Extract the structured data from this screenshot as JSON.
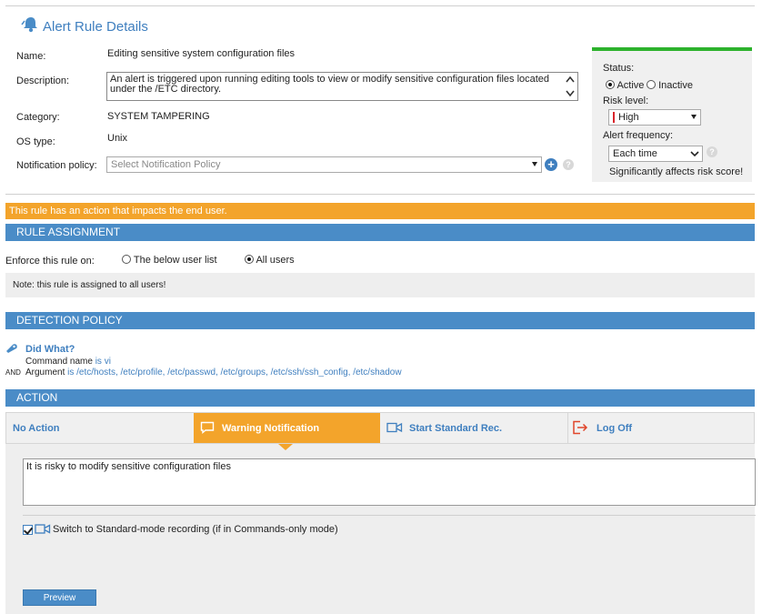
{
  "header": {
    "title": "Alert Rule Details",
    "icon": "bell-icon"
  },
  "details": {
    "name_label": "Name:",
    "name_value": "Editing sensitive system configuration files",
    "description_label": "Description:",
    "description_value": "An alert is triggered upon running editing tools to view or modify sensitive configuration files located under the /ETC directory.",
    "category_label": "Category:",
    "category_value": "SYSTEM TAMPERING",
    "os_label": "OS type:",
    "os_value": "Unix",
    "notification_label": "Notification policy:",
    "notification_placeholder": "Select Notification Policy",
    "add_symbol": "+",
    "help_symbol": "?"
  },
  "status_panel": {
    "status_label": "Status:",
    "active_label": "Active",
    "inactive_label": "Inactive",
    "active_selected": true,
    "risk_label": "Risk level:",
    "risk_value": "High",
    "risk_color": "#d9242b",
    "freq_label": "Alert frequency:",
    "freq_value": "Each time",
    "freq_note": "Significantly affects risk score!",
    "accent": "#2db22d"
  },
  "warning_bar": "This rule has an action that impacts the end user.",
  "rule_assignment": {
    "title": "RULE ASSIGNMENT",
    "enforce_label": "Enforce this rule on:",
    "option_user_list": "The below user list",
    "option_all_users": "All users",
    "all_users_selected": true,
    "note": "Note: this rule is assigned to all users!"
  },
  "detection_policy": {
    "title": "DETECTION POLICY",
    "heading": "Did What?",
    "cmd_label": "Command name",
    "cmd_op": "is",
    "cmd_value": "vi",
    "and_label": "AND",
    "arg_label": "Argument",
    "arg_op": "is",
    "arg_value": "/etc/hosts, /etc/profile, /etc/passwd, /etc/groups, /etc/ssh/ssh_config, /etc/shadow"
  },
  "action": {
    "title": "ACTION",
    "tabs": [
      {
        "label": "No Action",
        "icon": ""
      },
      {
        "label": "Warning Notification",
        "icon": "chat-bubble-icon"
      },
      {
        "label": "Start Standard Rec.",
        "icon": "video-camera-icon"
      },
      {
        "label": "Log Off",
        "icon": "log-off-icon"
      }
    ],
    "selected_tab": 1,
    "message": "It is risky to modify sensitive configuration files",
    "switch_label": "Switch to Standard-mode recording (if in Commands-only mode)",
    "switch_checked": true,
    "preview_label": "Preview"
  },
  "colors": {
    "brand_blue": "#3f7fbf",
    "section_blue": "#4a8cc7",
    "orange": "#f3a42b"
  }
}
